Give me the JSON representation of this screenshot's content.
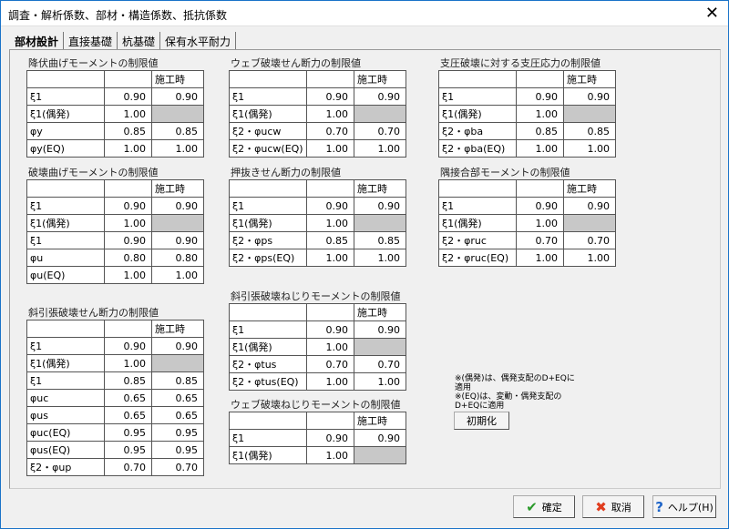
{
  "window": {
    "title": "調査・解析係数、部材・構造係数、抵抗係数"
  },
  "tabs": [
    "部材設計",
    "直接基礎",
    "杭基礎",
    "保有水平耐力"
  ],
  "header_col": "施工時",
  "groups": [
    {
      "title": "降伏曲げモーメントの制限値",
      "rows": [
        [
          "ξ1",
          "0.90",
          "0.90"
        ],
        [
          "ξ1(偶発)",
          "1.00",
          null
        ],
        [
          "φy",
          "0.85",
          "0.85"
        ],
        [
          "φy(EQ)",
          "1.00",
          "1.00"
        ]
      ]
    },
    {
      "title": "破壊曲げモーメントの制限値",
      "rows": [
        [
          "ξ1",
          "0.90",
          "0.90"
        ],
        [
          "ξ1(偶発)",
          "1.00",
          null
        ],
        [
          "ξ1",
          "0.90",
          "0.90"
        ],
        [
          "φu",
          "0.80",
          "0.80"
        ],
        [
          "φu(EQ)",
          "1.00",
          "1.00"
        ]
      ]
    },
    {
      "title": "斜引張破壊せん断力の制限値",
      "rows": [
        [
          "ξ1",
          "0.90",
          "0.90"
        ],
        [
          "ξ1(偶発)",
          "1.00",
          null
        ],
        [
          "ξ1",
          "0.85",
          "0.85"
        ],
        [
          "φuc",
          "0.65",
          "0.65"
        ],
        [
          "φus",
          "0.65",
          "0.65"
        ],
        [
          "φuc(EQ)",
          "0.95",
          "0.95"
        ],
        [
          "φus(EQ)",
          "0.95",
          "0.95"
        ],
        [
          "ξ2・φup",
          "0.70",
          "0.70"
        ]
      ]
    },
    {
      "title": "ウェブ破壊せん断力の制限値",
      "rows": [
        [
          "ξ1",
          "0.90",
          "0.90"
        ],
        [
          "ξ1(偶発)",
          "1.00",
          null
        ],
        [
          "ξ2・φucw",
          "0.70",
          "0.70"
        ],
        [
          "ξ2・φucw(EQ)",
          "1.00",
          "1.00"
        ]
      ]
    },
    {
      "title": "押抜きせん断力の制限値",
      "rows": [
        [
          "ξ1",
          "0.90",
          "0.90"
        ],
        [
          "ξ1(偶発)",
          "1.00",
          null
        ],
        [
          "ξ2・φps",
          "0.85",
          "0.85"
        ],
        [
          "ξ2・φps(EQ)",
          "1.00",
          "1.00"
        ]
      ]
    },
    {
      "title": "斜引張破壊ねじりモーメントの制限値",
      "rows": [
        [
          "ξ1",
          "0.90",
          "0.90"
        ],
        [
          "ξ1(偶発)",
          "1.00",
          null
        ],
        [
          "ξ2・φtus",
          "0.70",
          "0.70"
        ],
        [
          "ξ2・φtus(EQ)",
          "1.00",
          "1.00"
        ]
      ]
    },
    {
      "title": "ウェブ破壊ねじりモーメントの制限値",
      "rows": [
        [
          "ξ1",
          "0.90",
          "0.90"
        ],
        [
          "ξ1(偶発)",
          "1.00",
          null
        ]
      ]
    },
    {
      "title": "支圧破壊に対する支圧応力の制限値",
      "rows": [
        [
          "ξ1",
          "0.90",
          "0.90"
        ],
        [
          "ξ1(偶発)",
          "1.00",
          null
        ],
        [
          "ξ2・φba",
          "0.85",
          "0.85"
        ],
        [
          "ξ2・φba(EQ)",
          "1.00",
          "1.00"
        ]
      ]
    },
    {
      "title": "隅接合部モーメントの制限値",
      "rows": [
        [
          "ξ1",
          "0.90",
          "0.90"
        ],
        [
          "ξ1(偶発)",
          "1.00",
          null
        ],
        [
          "ξ2・φruc",
          "0.70",
          "0.70"
        ],
        [
          "ξ2・φruc(EQ)",
          "1.00",
          "1.00"
        ]
      ]
    }
  ],
  "notes": [
    "※(偶発)は、偶発支配のD+EQに適用",
    "※(EQ)は、変動・偶発支配のD+EQに適用"
  ],
  "buttons": {
    "init": "初期化",
    "ok": "確定",
    "cancel": "取消",
    "help": "ヘルプ(H)"
  },
  "colors": {
    "ok": "#2a9a2a",
    "cancel": "#e03c1e",
    "help": "#1e64c8"
  }
}
